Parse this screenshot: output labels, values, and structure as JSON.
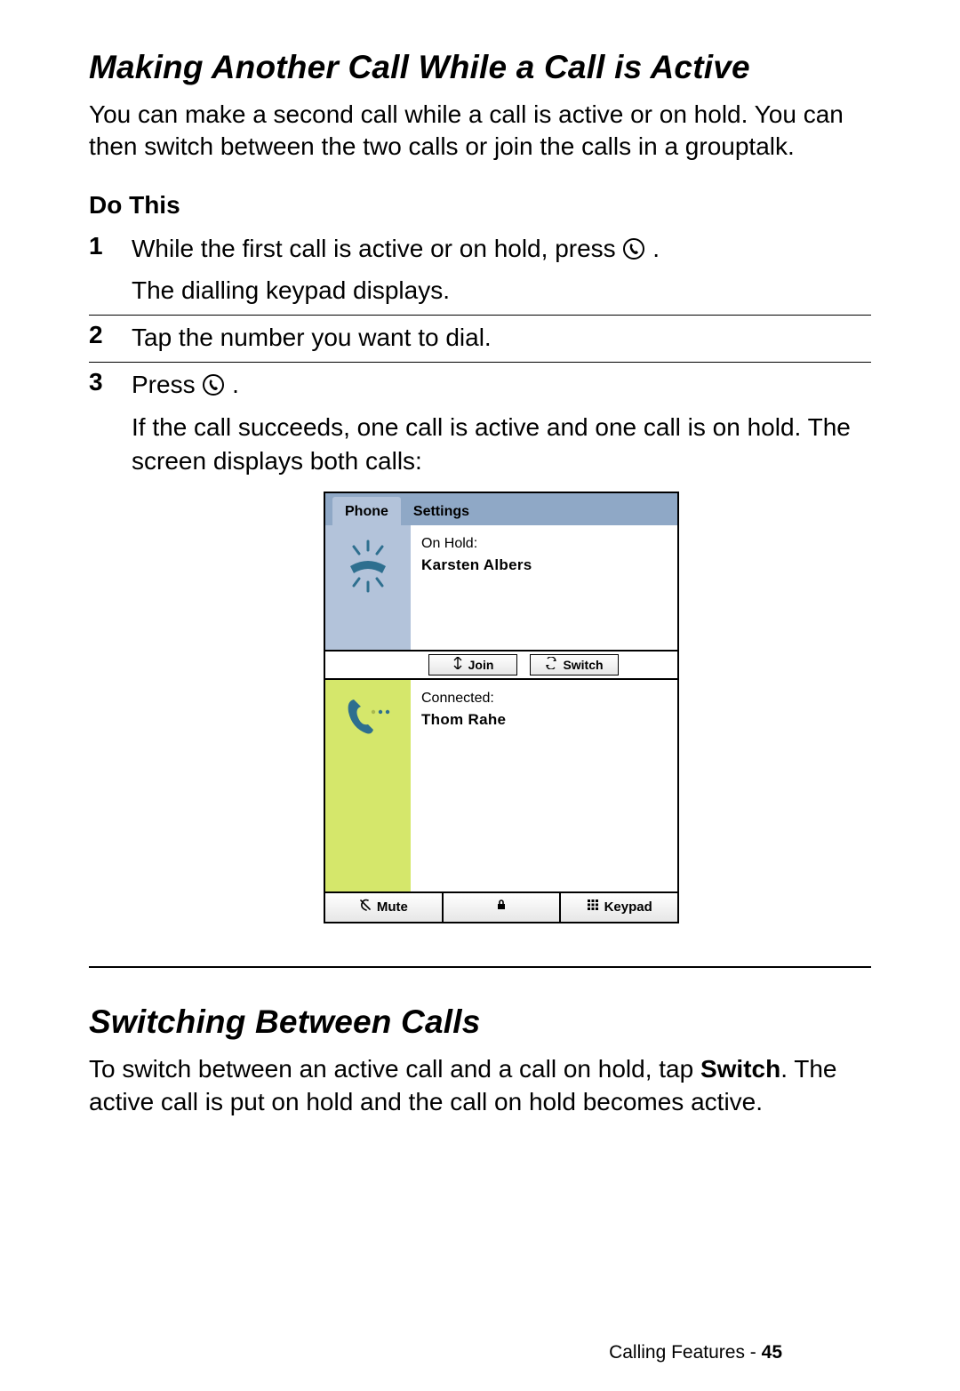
{
  "section1": {
    "title": "Making Another Call While a Call is Active",
    "intro": "You can make a second call while a call is active or on hold. You can then switch between the two calls or join the calls in a grouptalk.",
    "do_this": "Do This",
    "steps": [
      {
        "num": "1",
        "line1_pre": "While the first call is active or on hold, press ",
        "line1_post": ".",
        "line2": "The dialling keypad displays."
      },
      {
        "num": "2",
        "line1": "Tap the number you want to dial."
      },
      {
        "num": "3",
        "line1_pre": "Press ",
        "line1_post": ".",
        "line2": "If the call succeeds, one call is active and one call is on hold. The screen displays both calls:"
      }
    ]
  },
  "phone": {
    "tabs": {
      "phone": "Phone",
      "settings": "Settings"
    },
    "onhold": {
      "status": "On Hold:",
      "name": "Karsten Albers"
    },
    "actions": {
      "join": "Join",
      "switch": "Switch"
    },
    "connected": {
      "status": "Connected:",
      "name": "Thom Rahe"
    },
    "bottom": {
      "mute": "Mute",
      "keypad": "Keypad"
    }
  },
  "section2": {
    "title": "Switching Between Calls",
    "para_pre": "To switch between an active call and a call on hold, tap ",
    "switch_label": "Switch",
    "para_post": ". The active call is put on hold and the call on hold becomes active."
  },
  "footer": {
    "section": "Calling Features",
    "sep": " - ",
    "page": "45"
  }
}
